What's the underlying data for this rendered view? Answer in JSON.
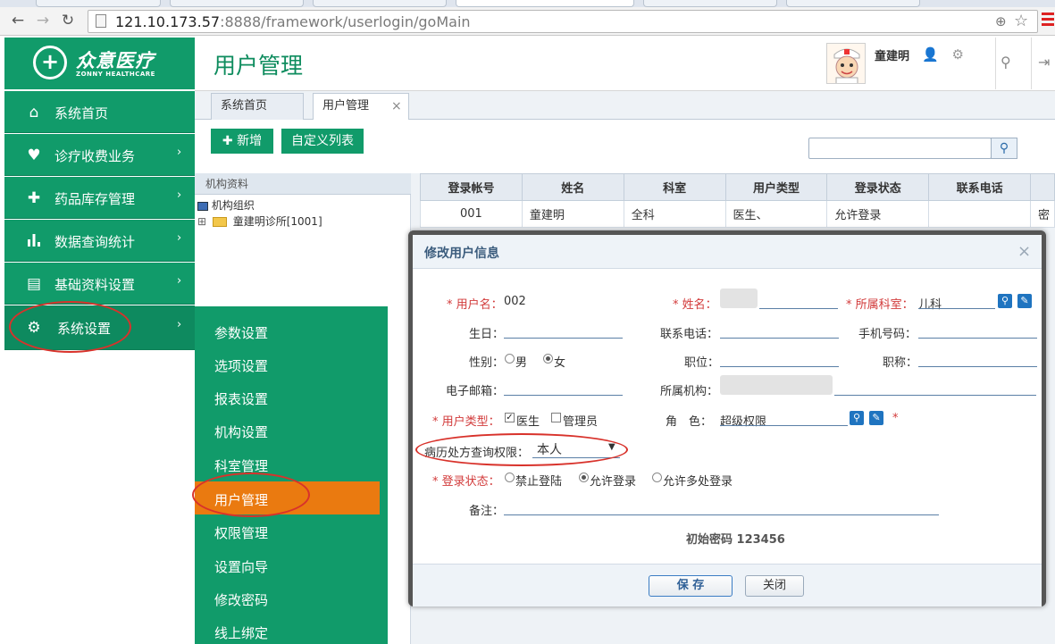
{
  "browser": {
    "url_host": "121.10.173.57",
    "url_rest": ":8888/framework/userlogin/goMain"
  },
  "logo": {
    "cn": "众意医疗",
    "en": "ZONNY HEALTHCARE",
    "mark": "+"
  },
  "header": {
    "title": "用户管理",
    "user_name": "童建明"
  },
  "sidebar": {
    "items": [
      {
        "label": "系统首页",
        "icon": "home-icon",
        "glyph": "⌂",
        "arrow": ""
      },
      {
        "label": "诊疗收费业务",
        "icon": "heart-plus-icon",
        "glyph": "♥",
        "arrow": "›"
      },
      {
        "label": "药品库存管理",
        "icon": "medkit-icon",
        "glyph": "✚",
        "arrow": "›"
      },
      {
        "label": "数据查询统计",
        "icon": "bar-chart-icon",
        "glyph": "▮",
        "arrow": "›"
      },
      {
        "label": "基础资料设置",
        "icon": "document-icon",
        "glyph": "▤",
        "arrow": "›"
      },
      {
        "label": "系统设置",
        "icon": "gear-icon",
        "glyph": "⚙",
        "arrow": "›"
      }
    ]
  },
  "submenu": {
    "items": [
      "参数设置",
      "选项设置",
      "报表设置",
      "机构设置",
      "科室管理",
      "用户管理",
      "权限管理",
      "设置向导",
      "修改密码",
      "线上绑定"
    ]
  },
  "tabs": [
    {
      "label": "系统首页"
    },
    {
      "label": "用户管理",
      "close": "×"
    }
  ],
  "toolbar": {
    "add": "新增",
    "add_icon": "✚",
    "custom": "自定义列表"
  },
  "tree": {
    "header": "机构资料",
    "root": "机构组织",
    "node": "童建明诊所[1001]",
    "expander": "⊞"
  },
  "grid": {
    "columns": [
      "登录帐号",
      "姓名",
      "科室",
      "用户类型",
      "登录状态",
      "联系电话"
    ],
    "rows": [
      [
        "001",
        "童建明",
        "全科",
        "医生、",
        "允许登录",
        ""
      ]
    ],
    "edge_text": "密"
  },
  "modal": {
    "title": "修改用户信息",
    "close": "×",
    "username_label": "用户名：",
    "username_value": "002",
    "name_label": "姓名：",
    "dept_label": "所属科室：",
    "dept_value": "儿科",
    "birthday_label": "生日：",
    "phone_label": "联系电话：",
    "mobile_label": "手机号码：",
    "gender_label": "性别：",
    "gender_options": [
      "男",
      "女"
    ],
    "gender_selected": "女",
    "position_label": "职位：",
    "title_label": "职称：",
    "email_label": "电子邮箱：",
    "org_label": "所属机构：",
    "usertype_label": "用户类型：",
    "usertype_options": [
      {
        "label": "医生",
        "checked": true
      },
      {
        "label": "管理员",
        "checked": false
      }
    ],
    "role_label": "角　色：",
    "role_value": "超级权限",
    "record_label": "病历处方查询权限：",
    "record_value": "本人",
    "record_arrow": "▼",
    "login_label": "登录状态：",
    "login_options": [
      "禁止登陆",
      "允许登录",
      "允许多处登录"
    ],
    "login_selected": "允许登录",
    "remark_label": "备注：",
    "init_pwd": "初始密码 123456",
    "save": "保 存",
    "cancel": "关闭",
    "req_mark": "*"
  },
  "colors": {
    "brand_green": "#119b6a",
    "menu_selected": "#ea7a10",
    "annotation_red": "#d8322b"
  }
}
